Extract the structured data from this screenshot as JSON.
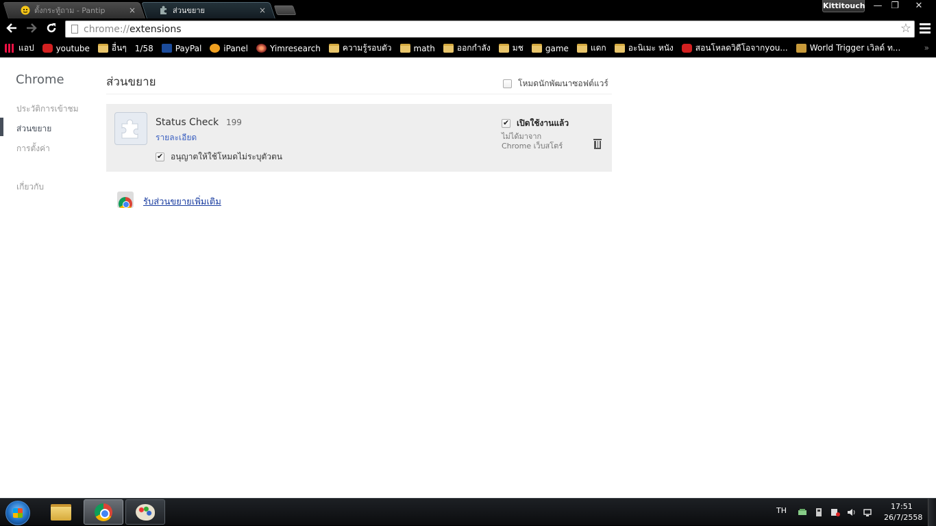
{
  "tabs": [
    {
      "label": "ตั้งกระทู้ถาม - Pantip",
      "close": "×"
    },
    {
      "label": "ส่วนขยาย",
      "close": "×"
    }
  ],
  "profile": {
    "name": "Kittitouch"
  },
  "window_controls": {
    "minimize": "—",
    "restore": "❐",
    "close": "✕"
  },
  "toolbar": {
    "back": "🡐",
    "forward": "🡒",
    "reload": "↻",
    "url_scheme": "chrome://",
    "url_path": "extensions",
    "star": "☆"
  },
  "bookmarks": [
    {
      "label": "แอป",
      "icon": "apps-icon"
    },
    {
      "label": "youtube",
      "icon": "youtube-icon"
    },
    {
      "label": "อื่นๆ",
      "icon": "folder-icon"
    },
    {
      "label": "1/58",
      "icon": "page-icon"
    },
    {
      "label": "PayPal",
      "icon": "paypal-icon"
    },
    {
      "label": "iPanel",
      "icon": "ipanel-icon"
    },
    {
      "label": "Yimresearch",
      "icon": "yimresearch-icon"
    },
    {
      "label": "ความรู้รอบตัว",
      "icon": "folder-icon"
    },
    {
      "label": "math",
      "icon": "folder-icon"
    },
    {
      "label": "ออกกำลัง",
      "icon": "folder-icon"
    },
    {
      "label": "มช",
      "icon": "folder-icon"
    },
    {
      "label": "game",
      "icon": "folder-icon"
    },
    {
      "label": "แดก",
      "icon": "folder-icon"
    },
    {
      "label": "อะนิเมะ หนัง",
      "icon": "folder-icon"
    },
    {
      "label": "สอนโหลดวิดีโอจากyou...",
      "icon": "youtube-icon"
    },
    {
      "label": "World Trigger เวิลด์ ท...",
      "icon": "worldtrigger-icon"
    }
  ],
  "bookmarks_overflow": "»",
  "sidebar": {
    "title": "Chrome",
    "items": [
      {
        "label": "ประวัติการเข้าชม"
      },
      {
        "label": "ส่วนขยาย"
      },
      {
        "label": "การตั้งค่า"
      },
      {
        "label": "เกี่ยวกับ"
      }
    ]
  },
  "header": {
    "title": "ส่วนขยาย",
    "dev_mode_label": "โหมดนักพัฒนาซอฟต์แวร์",
    "dev_mode_checked": false
  },
  "extension": {
    "name": "Status Check",
    "version": "199",
    "details_link": "รายละเอียด",
    "incognito_label": "อนุญาตให้ใช้โหมดไม่ระบุตัวตน",
    "incognito_checked": true,
    "enabled_label": "เปิดใช้งานแล้ว",
    "enabled_checked": true,
    "source_line1": "ไม่ได้มาจาก",
    "source_line2": "Chrome เว็บสโตร์"
  },
  "get_more": {
    "label": "รับส่วนขยายเพิ่มเติม"
  },
  "taskbar": {
    "language": "TH",
    "time": "17:51",
    "date": "26/7/2558"
  }
}
